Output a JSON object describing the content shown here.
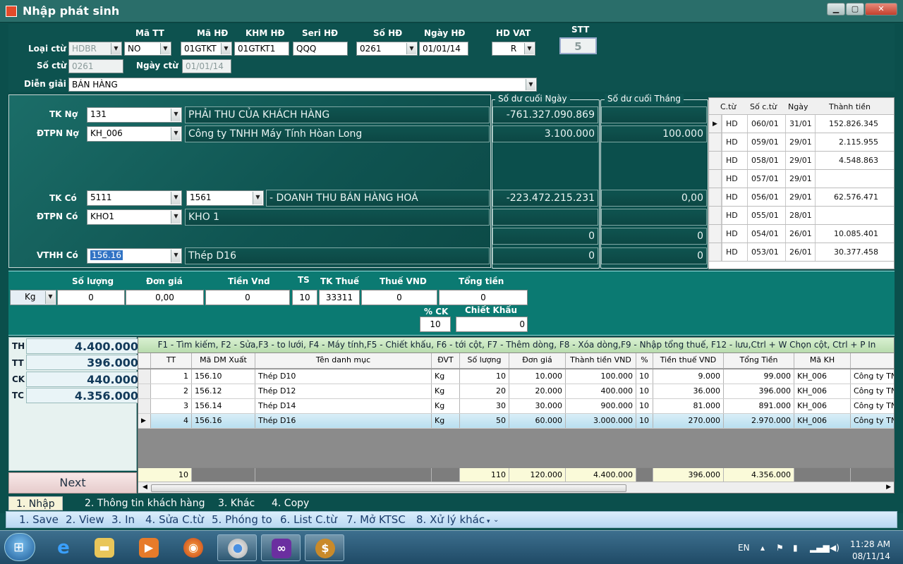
{
  "window": {
    "title": "Nhập phát sinh"
  },
  "header": {
    "loai_ctu_label": "Loại ctừ",
    "loai_ctu": "HDBR",
    "ma_tt_label": "Mã TT",
    "ma_tt": "NO",
    "ma_hd_label": "Mã HĐ",
    "ma_hd": "01GTKT",
    "khm_hd_label": "KHM HĐ",
    "khm_hd": "01GTKT1",
    "seri_hd_label": "Seri HĐ",
    "seri_hd": "QQQ",
    "so_hd_label": "Số HĐ",
    "so_hd": "0261",
    "ngay_hd_label": "Ngày HĐ",
    "ngay_hd": "01/01/14",
    "hd_vat_label": "HD VAT",
    "hd_vat": "R",
    "stt_label": "STT",
    "stt": "5",
    "so_ctu_label": "Số ctừ",
    "so_ctu": "0261",
    "ngay_ctu_label": "Ngày ctừ",
    "ngay_ctu": "01/01/14",
    "dien_giai_label": "Diễn giải",
    "dien_giai": "BÁN HÀNG"
  },
  "accounts": {
    "tk_no_label": "TK Nợ",
    "tk_no": "131",
    "tk_no_name": "PHẢI THU CỦA KHÁCH HÀNG",
    "dtpn_no_label": "ĐTPN Nợ",
    "dtpn_no": "KH_006",
    "dtpn_no_name": "Công ty TNHH Máy Tính Hòan Long",
    "tk_co_label": "TK Có",
    "tk_co": "5111",
    "tk_co2": "1561",
    "tk_co_name": "- DOANH THU BÁN HÀNG HOÁ",
    "dtpn_co_label": "ĐTPN Có",
    "dtpn_co": "KHO1",
    "dtpn_co_name": "KHO 1",
    "vthh_co_label": "VTHH Có",
    "vthh_co": "156.16",
    "vthh_co_name": "Thép D16"
  },
  "balances": {
    "ngay_legend": "Số dư cuối Ngày",
    "thang_legend": "Số dư cuối Tháng",
    "r1_ngay": "-761.327.090.869",
    "r1_thang": "",
    "r2_ngay": "3.100.000",
    "r2_thang": "100.000",
    "r3_ngay": "-223.472.215.231",
    "r3_thang": "0,00",
    "r4_ngay": "",
    "r4_thang": "",
    "r5_ngay": "0",
    "r5_thang": "0",
    "r6_ngay": "0",
    "r6_thang": "0"
  },
  "mini_grid": {
    "headers": [
      "C.từ",
      "Số c.từ",
      "Ngày",
      "Thành tiền"
    ],
    "rows": [
      [
        "HD",
        "060/01",
        "31/01",
        "152.826.345"
      ],
      [
        "HD",
        "059/01",
        "29/01",
        "2.115.955"
      ],
      [
        "HD",
        "058/01",
        "29/01",
        "4.548.863"
      ],
      [
        "HD",
        "057/01",
        "29/01",
        ""
      ],
      [
        "HD",
        "056/01",
        "29/01",
        "62.576.471"
      ],
      [
        "HD",
        "055/01",
        "28/01",
        ""
      ],
      [
        "HD",
        "054/01",
        "26/01",
        "10.085.401"
      ],
      [
        "HD",
        "053/01",
        "26/01",
        "30.377.458"
      ]
    ]
  },
  "line": {
    "unit": "Kg",
    "so_luong_label": "Số lượng",
    "so_luong": "0",
    "don_gia_label": "Đơn giá",
    "don_gia": "0,00",
    "tien_vnd_label": "Tiền Vnd",
    "tien_vnd": "0",
    "ts_label": "TS",
    "ts": "10",
    "tk_thue_label": "TK Thuế",
    "tk_thue": "33311",
    "thue_vnd_label": "Thuế VND",
    "thue_vnd": "0",
    "tong_tien_label": "Tổng tiền",
    "tong_tien": "0",
    "pct_ck_label": "% CK",
    "pct_ck": "10",
    "chiet_khau_label": "Chiết Khấu",
    "chiet_khau": "0"
  },
  "summary": {
    "th_label": "TH",
    "th": "4.400.000",
    "tt_label": "TT",
    "tt": "396.000",
    "ck_label": "CK",
    "ck": "440.000",
    "tc_label": "TC",
    "tc": "4.356.000",
    "next": "Next"
  },
  "grid": {
    "hint": "F1 - Tìm kiếm, F2 - Sửa,F3 - to lưới, F4 - Máy tính,F5 - Chiết khấu, F6 - tới cột, F7 - Thêm dòng, F8 - Xóa dòng,F9 - Nhập tổng thuế, F12 - lưu,Ctrl + W Chọn cột, Ctrl + P In",
    "headers": [
      "TT",
      "Mã DM Xuất",
      "Tên danh mục",
      "ĐVT",
      "Số lượng",
      "Đơn giá",
      "Thành tiền VND",
      "%",
      "Tiền thuế VND",
      "Tổng Tiền",
      "Mã KH",
      ""
    ],
    "rows": [
      [
        "1",
        "156.10",
        "Thép D10",
        "Kg",
        "10",
        "10.000",
        "100.000",
        "10",
        "9.000",
        "99.000",
        "KH_006",
        "Công ty TNHH"
      ],
      [
        "2",
        "156.12",
        "Thép D12",
        "Kg",
        "20",
        "20.000",
        "400.000",
        "10",
        "36.000",
        "396.000",
        "KH_006",
        "Công ty TNHH"
      ],
      [
        "3",
        "156.14",
        "Thép D14",
        "Kg",
        "30",
        "30.000",
        "900.000",
        "10",
        "81.000",
        "891.000",
        "KH_006",
        "Công ty TNHH"
      ],
      [
        "4",
        "156.16",
        "Thép D16",
        "Kg",
        "50",
        "60.000",
        "3.000.000",
        "10",
        "270.000",
        "2.970.000",
        "KH_006",
        "Công ty TNHH"
      ]
    ],
    "footer": {
      "tt": "10",
      "so_luong": "110",
      "don_gia": "120.000",
      "thanh_tien": "4.400.000",
      "tien_thue": "396.000",
      "tong_tien": "4.356.000"
    }
  },
  "tabs": [
    "1. Nhập",
    "2. Thông tin khách hàng",
    "3. Khác",
    "4. Copy"
  ],
  "menu": [
    "1. Save",
    "2. View",
    "3. In",
    "4. Sửa C.từ",
    "5. Phóng to",
    "6. List C.từ",
    "7. Mở KTSC",
    "8. Xử lý khác"
  ],
  "taskbar": {
    "lang": "EN",
    "time": "11:28 AM",
    "date": "08/11/14"
  }
}
